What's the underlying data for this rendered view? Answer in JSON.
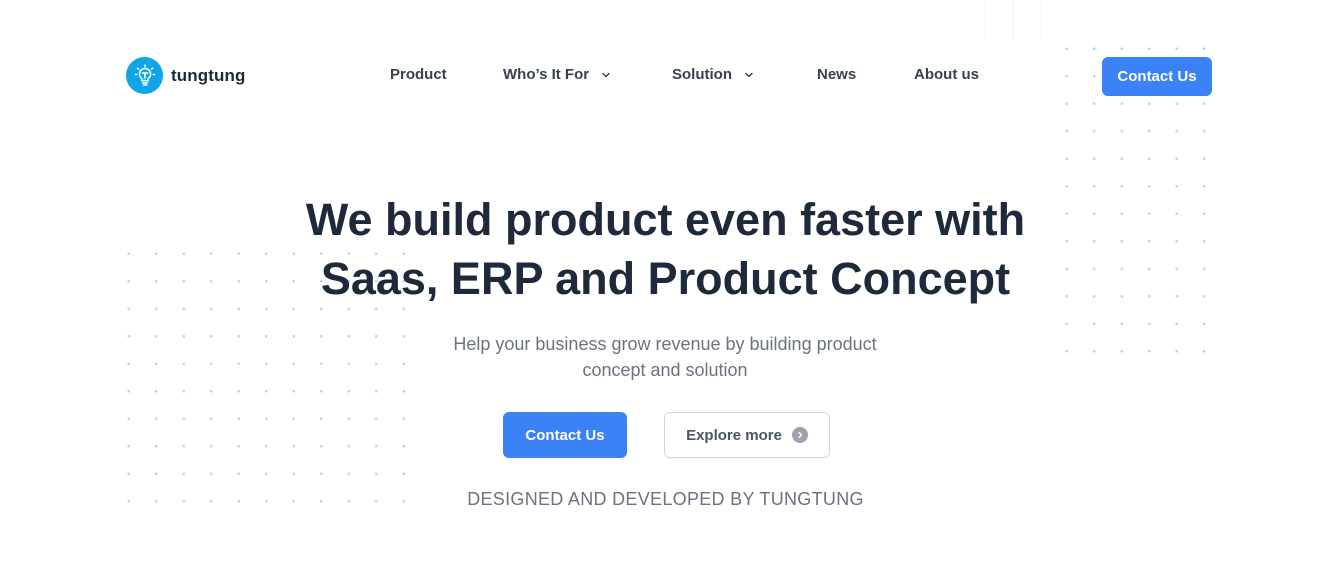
{
  "brand": {
    "name": "tungtung",
    "logo_icon": "lightbulb-icon",
    "logo_color": "#0ea5e9"
  },
  "nav": {
    "items": [
      {
        "label": "Product",
        "has_dropdown": false
      },
      {
        "label": "Who’s It For",
        "has_dropdown": true
      },
      {
        "label": "Solution",
        "has_dropdown": true
      },
      {
        "label": "News",
        "has_dropdown": false
      },
      {
        "label": "About us",
        "has_dropdown": false
      }
    ],
    "cta_label": "Contact Us"
  },
  "hero": {
    "title_line1": "We build product even faster with",
    "title_line2": "Saas, ERP and Product Concept",
    "subtitle_line1": "Help your business grow revenue by building product",
    "subtitle_line2": "concept and solution",
    "primary_cta": "Contact Us",
    "secondary_cta": "Explore more",
    "secondary_icon": "arrow-right-icon",
    "tagline": "DESIGNED AND DEVELOPED BY TUNGTUNG"
  },
  "colors": {
    "accent": "#3b82f6",
    "heading": "#1e293b",
    "muted": "#6b7280",
    "dot_pattern": "#a9e3ea"
  }
}
